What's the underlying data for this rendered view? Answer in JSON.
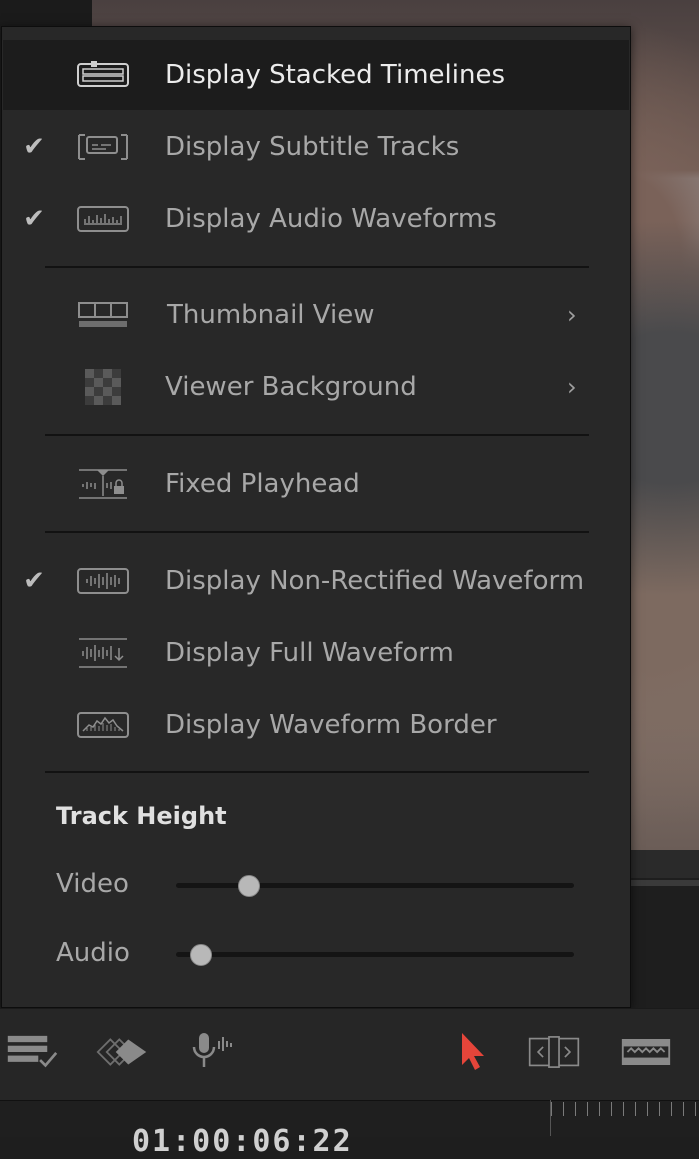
{
  "menu": {
    "items": [
      {
        "label": "Display Stacked Timelines",
        "checked": false,
        "icon": "stacked-timelines-icon",
        "submenu": false,
        "highlighted": true
      },
      {
        "label": "Display Subtitle Tracks",
        "checked": true,
        "icon": "subtitle-tracks-icon",
        "submenu": false
      },
      {
        "label": "Display Audio Waveforms",
        "checked": true,
        "icon": "audio-waveforms-icon",
        "submenu": false
      },
      {
        "label": "Thumbnail View",
        "checked": false,
        "icon": "thumbnail-view-icon",
        "submenu": true
      },
      {
        "label": "Viewer Background",
        "checked": false,
        "icon": "viewer-background-icon",
        "submenu": true
      },
      {
        "label": "Fixed Playhead",
        "checked": false,
        "icon": "fixed-playhead-icon",
        "submenu": false
      },
      {
        "label": "Display Non-Rectified Waveform",
        "checked": true,
        "icon": "non-rectified-waveform-icon",
        "submenu": false
      },
      {
        "label": "Display Full Waveform",
        "checked": false,
        "icon": "full-waveform-icon",
        "submenu": false
      },
      {
        "label": "Display Waveform Border",
        "checked": false,
        "icon": "waveform-border-icon",
        "submenu": false
      }
    ],
    "check_glyph": "✔",
    "chevron_glyph": "›",
    "track_height": {
      "title": "Track Height",
      "video_label": "Video",
      "audio_label": "Audio",
      "video_value": 0.18,
      "audio_value": 0.06
    }
  },
  "toolbar": {
    "icons": [
      "timeline-view-options-icon",
      "snapping-icon",
      "voiceover-mic-icon",
      "selection-pointer-icon",
      "trim-edit-icon",
      "blade-edit-icon"
    ],
    "active_color": "#e5453a"
  },
  "timecode": "01:00:06:22"
}
